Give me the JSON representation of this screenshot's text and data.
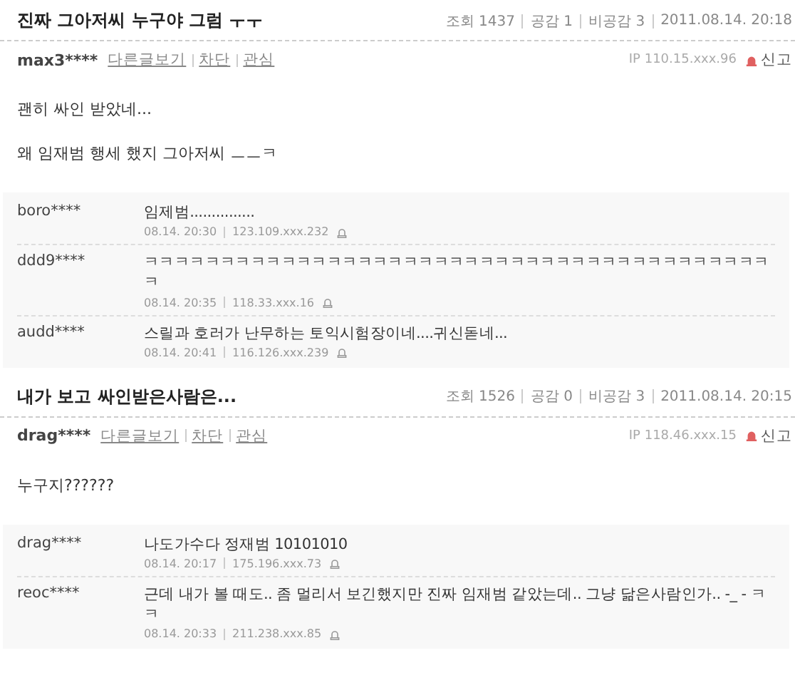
{
  "posts": [
    {
      "title": "진짜 그아저씨 누구야 그럼 ㅜㅜ",
      "views_label": "조회",
      "views": "1437",
      "likes_label": "공감",
      "likes": "1",
      "dislikes_label": "비공감",
      "dislikes": "3",
      "date": "2011.08.14. 20:18",
      "author": "max3****",
      "links": [
        "다른글보기",
        "차단",
        "관심"
      ],
      "ip": "IP 110.15.xxx.96",
      "report": "신고",
      "body": [
        "괜히 싸인 받았네...",
        "왜 임재범 행세 했지 그아저씨 ㅡㅡㅋ"
      ],
      "comments": [
        {
          "author": "boro****",
          "text": "임제범...............",
          "time": "08.14. 20:30",
          "ip": "123.109.xxx.232"
        },
        {
          "author": "ddd9****",
          "text": "ㅋㅋㅋㅋㅋㅋㅋㅋㅋㅋㅋㅋㅋㅋㅋㅋㅋㅋㅋㅋㅋㅋㅋㅋㅋㅋㅋㅋㅋㅋㅋㅋㅋㅋㅋㅋㅋㅋㅋㅋㅋㅋ",
          "time": "08.14. 20:35",
          "ip": "118.33.xxx.16"
        },
        {
          "author": "audd****",
          "text": "스릴과 호러가 난무하는 토익시험장이네....귀신돋네...",
          "time": "08.14. 20:41",
          "ip": "116.126.xxx.239"
        }
      ]
    },
    {
      "title": "내가 보고 싸인받은사람은...",
      "views_label": "조회",
      "views": "1526",
      "likes_label": "공감",
      "likes": "0",
      "dislikes_label": "비공감",
      "dislikes": "3",
      "date": "2011.08.14. 20:15",
      "author": "drag****",
      "links": [
        "다른글보기",
        "차단",
        "관심"
      ],
      "ip": "IP 118.46.xxx.15",
      "report": "신고",
      "body": [
        "누구지??????"
      ],
      "comments": [
        {
          "author": "drag****",
          "text": "나도가수다 정재범 10101010",
          "time": "08.14. 20:17",
          "ip": "175.196.xxx.73"
        },
        {
          "author": "reoc****",
          "text": "근데 내가 볼 때도.. 좀 멀리서 보긴했지만 진짜 임재범 같았는데.. 그냥 닮은사람인가.. -_ - ㅋㅋ",
          "time": "08.14. 20:33",
          "ip": "211.238.xxx.85"
        }
      ]
    }
  ]
}
